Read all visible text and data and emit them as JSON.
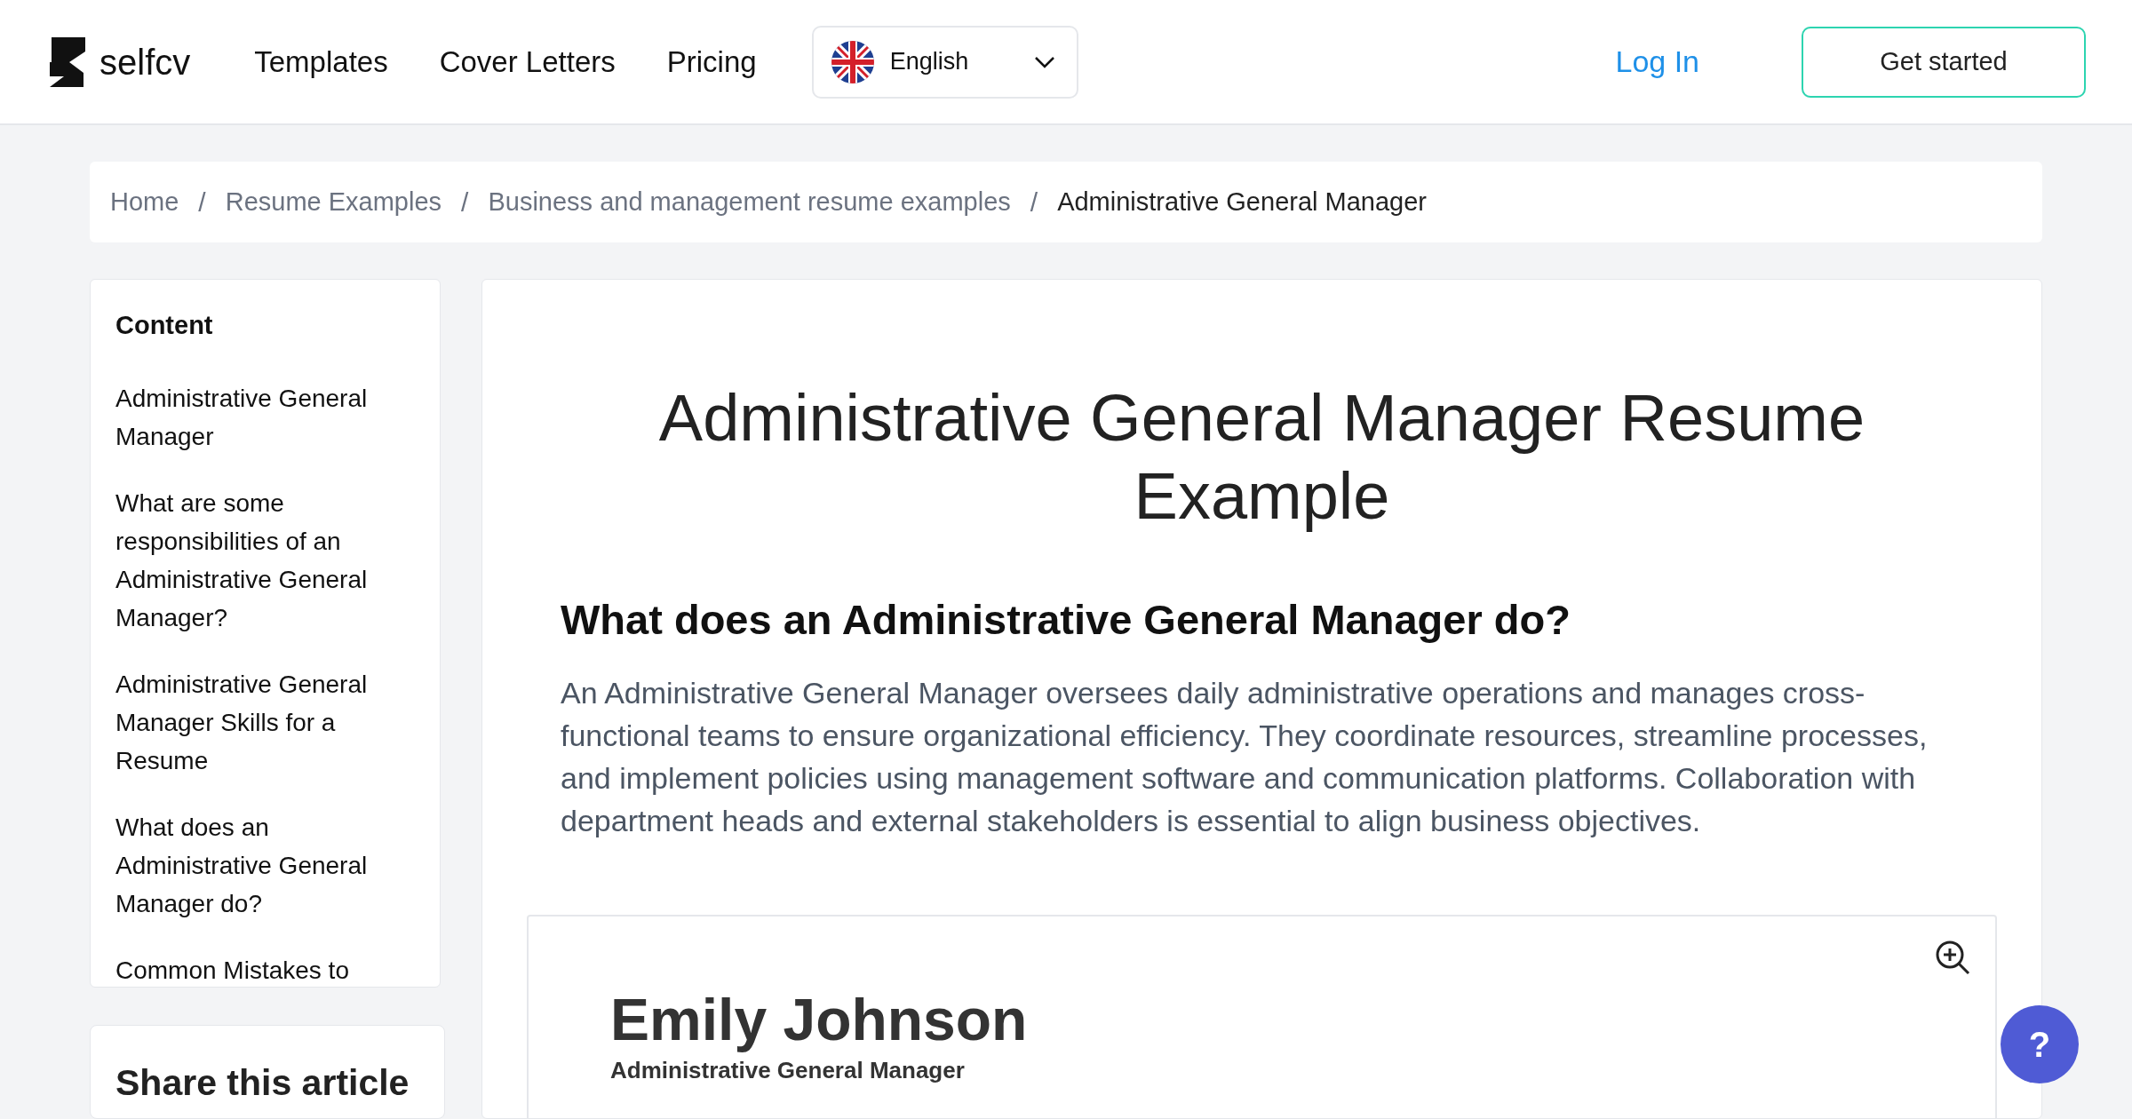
{
  "header": {
    "logo": "selfcv",
    "nav": [
      "Templates",
      "Cover Letters",
      "Pricing"
    ],
    "language": "English",
    "login": "Log In",
    "cta": "Get started"
  },
  "breadcrumb": [
    "Home",
    "Resume Examples",
    "Business and management resume examples",
    "Administrative General Manager"
  ],
  "breadcrumb_separators": [
    "/",
    "/",
    "/"
  ],
  "sidebar": {
    "title": "Content",
    "items": [
      "Administrative General Manager",
      "What are some responsibilities of an Administrative General Manager?",
      "Administrative General Manager Skills for a Resume",
      "What does an Administrative General Manager do?",
      "Common Mistakes to"
    ]
  },
  "share": {
    "title": "Share this article"
  },
  "article": {
    "title": "Administrative General Manager Resume Example",
    "heading": "What does an Administrative General Manager do?",
    "paragraph": "An Administrative General Manager oversees daily administrative operations and manages cross-functional teams to ensure organizational efficiency. They coordinate resources, streamline processes, and implement policies using management software and communication platforms. Collaboration with department heads and external stakeholders is essential to align business objectives."
  },
  "resume": {
    "name": "Emily Johnson",
    "role": "Administrative General Manager"
  },
  "help": "?"
}
